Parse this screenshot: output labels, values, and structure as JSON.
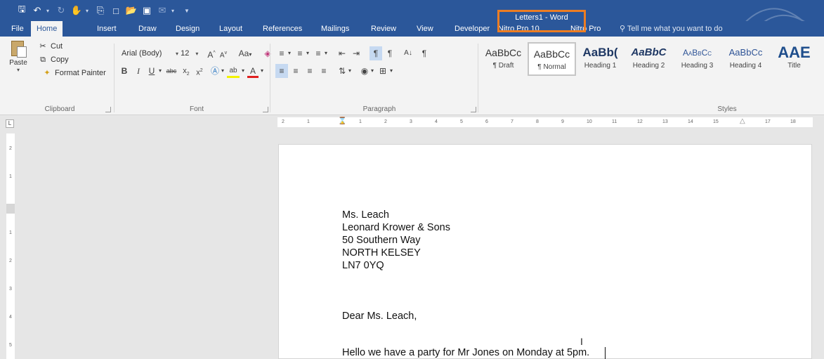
{
  "window": {
    "title": "Letters1  -  Word"
  },
  "tabs": [
    "File",
    "Home",
    "Insert",
    "Draw",
    "Design",
    "Layout",
    "References",
    "Mailings",
    "Review",
    "View",
    "Developer",
    "Nitro Pro 10",
    "Nitro Pro"
  ],
  "active_tab": "Home",
  "tell_me": "Tell me what you want to do",
  "clipboard": {
    "paste": "Paste",
    "cut": "Cut",
    "copy": "Copy",
    "format_painter": "Format Painter",
    "label": "Clipboard"
  },
  "font": {
    "name": "Arial (Body)",
    "size": "12",
    "change_case": "Aa",
    "label": "Font"
  },
  "paragraph": {
    "label": "Paragraph"
  },
  "styles": {
    "label": "Styles",
    "items": [
      {
        "sample": "AaBbCc",
        "name": "¶ Draft"
      },
      {
        "sample": "AaBbCc",
        "name": "¶ Normal"
      },
      {
        "sample": "AaBb(",
        "name": "Heading 1"
      },
      {
        "sample": "AaBbC",
        "name": "Heading 2"
      },
      {
        "sample": "AaBbCc",
        "name": "Heading 3"
      },
      {
        "sample": "AaBbCc",
        "name": "Heading 4"
      },
      {
        "sample": "AAE",
        "name": "Title"
      }
    ],
    "selected": "¶ Normal"
  },
  "ruler": {
    "ticks": [
      "2",
      "1",
      "1",
      "2",
      "3",
      "4",
      "5",
      "6",
      "7",
      "8",
      "9",
      "10",
      "11",
      "12",
      "13",
      "14",
      "15",
      "17",
      "18"
    ]
  },
  "vruler": {
    "ticks": [
      "2",
      "1",
      "1",
      "2",
      "3",
      "4",
      "5"
    ]
  },
  "document": {
    "address": [
      "Ms. Leach",
      "Leonard Krower & Sons",
      "50 Southern Way",
      "NORTH KELSEY",
      "LN7 0YQ"
    ],
    "salutation": "Dear Ms. Leach,",
    "body": "Hello we have a party for Mr Jones on Monday at 5pm."
  },
  "colors": {
    "ribbon_blue": "#2b579a",
    "highlight_box": "#ec7d23",
    "ribbon_bg": "#f3f3f3"
  },
  "icons": {
    "save": "save-icon",
    "undo": "undo-icon",
    "redo": "redo-icon",
    "lightbulb": "lightbulb-icon"
  }
}
